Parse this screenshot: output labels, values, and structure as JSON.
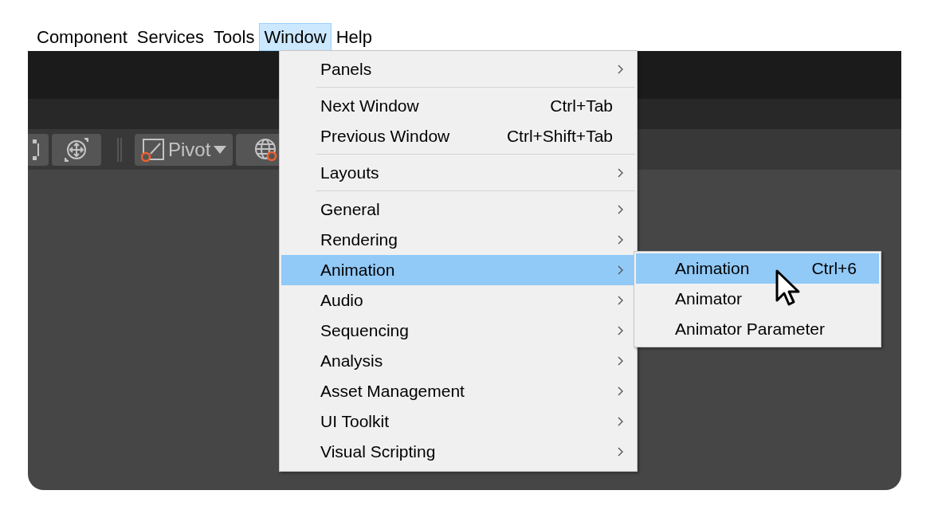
{
  "menubar": [
    {
      "label": "Component",
      "selected": false
    },
    {
      "label": "Services",
      "selected": false
    },
    {
      "label": "Tools",
      "selected": false
    },
    {
      "label": "Window",
      "selected": true
    },
    {
      "label": "Help",
      "selected": false
    }
  ],
  "toolbar": {
    "pivot": {
      "label": "Pivot"
    }
  },
  "window_menu": [
    {
      "kind": "item",
      "label": "Panels",
      "submenu": true,
      "selected": false
    },
    {
      "kind": "separator"
    },
    {
      "kind": "item",
      "label": "Next Window",
      "shortcut": "Ctrl+Tab",
      "selected": false
    },
    {
      "kind": "item",
      "label": "Previous Window",
      "shortcut": "Ctrl+Shift+Tab",
      "selected": false
    },
    {
      "kind": "separator"
    },
    {
      "kind": "item",
      "label": "Layouts",
      "submenu": true,
      "selected": false
    },
    {
      "kind": "separator"
    },
    {
      "kind": "item",
      "label": "General",
      "submenu": true,
      "selected": false
    },
    {
      "kind": "item",
      "label": "Rendering",
      "submenu": true,
      "selected": false
    },
    {
      "kind": "item",
      "label": "Animation",
      "submenu": true,
      "selected": true
    },
    {
      "kind": "item",
      "label": "Audio",
      "submenu": true,
      "selected": false
    },
    {
      "kind": "item",
      "label": "Sequencing",
      "submenu": true,
      "selected": false
    },
    {
      "kind": "item",
      "label": "Analysis",
      "submenu": true,
      "selected": false
    },
    {
      "kind": "item",
      "label": "Asset Management",
      "submenu": true,
      "selected": false
    },
    {
      "kind": "item",
      "label": "UI Toolkit",
      "submenu": true,
      "selected": false
    },
    {
      "kind": "item",
      "label": "Visual Scripting",
      "submenu": true,
      "selected": false
    }
  ],
  "animation_submenu": [
    {
      "label": "Animation",
      "shortcut": "Ctrl+6",
      "selected": true
    },
    {
      "label": "Animator",
      "selected": false
    },
    {
      "label": "Animator Parameter",
      "selected": false
    }
  ]
}
